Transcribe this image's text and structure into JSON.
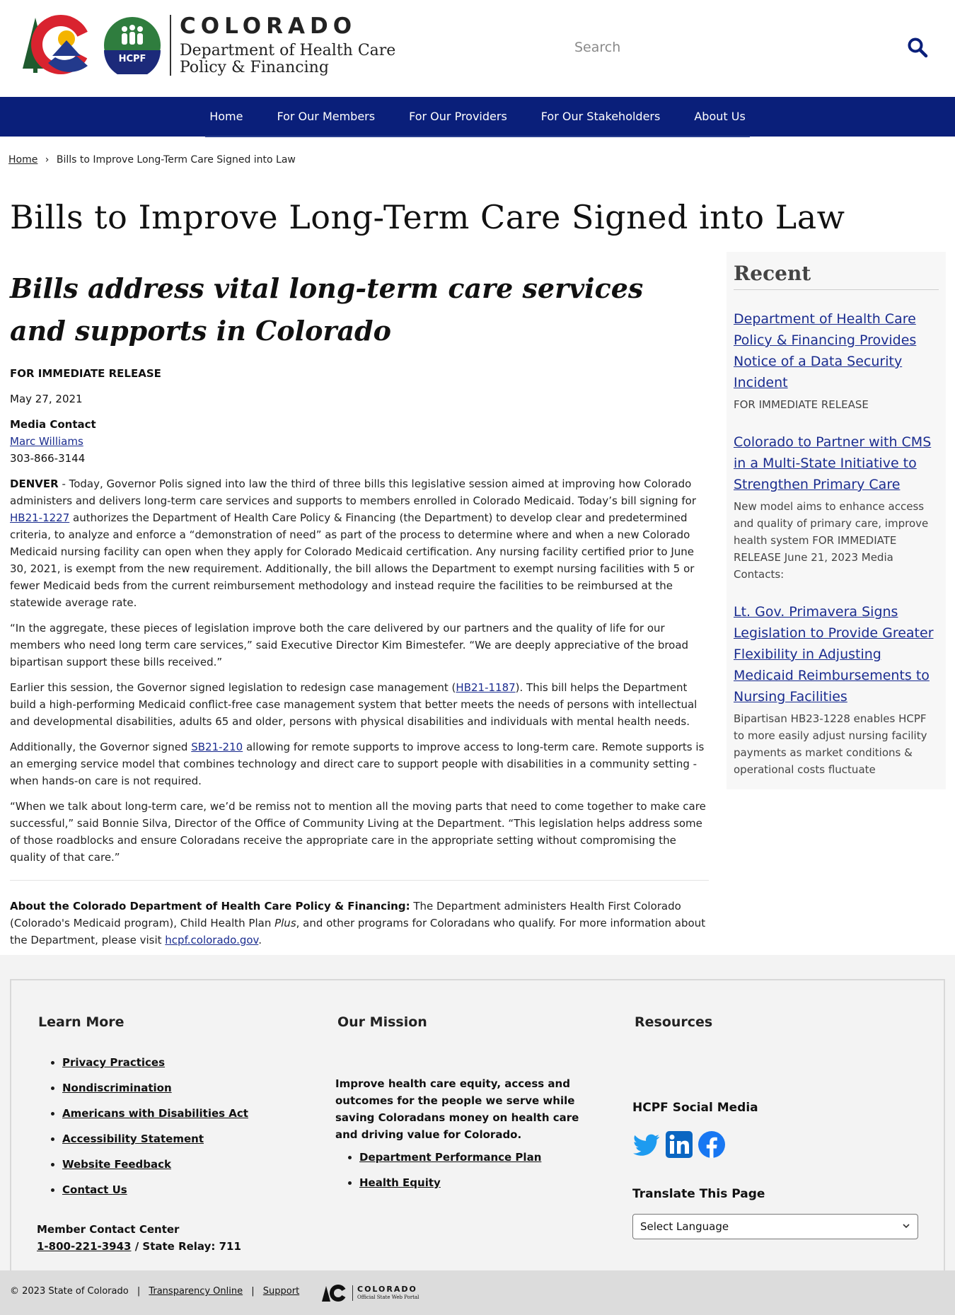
{
  "header": {
    "logo_state": "COLORADO",
    "logo_dept_line1": "Department of Health Care",
    "logo_dept_line2": "Policy & Financing",
    "hcpf_badge": "HCPF",
    "search_placeholder": "Search"
  },
  "nav": {
    "items": [
      "Home",
      "For Our Members",
      "For Our Providers",
      "For Our Stakeholders",
      "About Us"
    ]
  },
  "breadcrumb": {
    "home": "Home",
    "separator": "›",
    "current": "Bills to Improve Long-Term Care Signed into Law"
  },
  "page_title": "Bills to Improve Long-Term Care Signed into Law",
  "article": {
    "subtitle": "Bills address vital long-term care services and supports in Colorado",
    "release": "FOR IMMEDIATE RELEASE",
    "date": "May 27, 2021",
    "contact_label": "Media Contact",
    "contact_name": "Marc Williams",
    "contact_phone": "303-866-3144",
    "p1_lead": "DENVER",
    "p1_a": " - Today, Governor Polis signed into law the third of three bills this legislative session aimed at improving how Colorado administers and delivers long-term care services and supports to members enrolled in Colorado Medicaid. Today’s bill signing for ",
    "p1_link": "HB21-1227",
    "p1_b": " authorizes the Department of Health Care Policy & Financing (the Department) to develop clear and predetermined criteria, to analyze and enforce a “demonstration of need” as part of the process to determine where and when a new Colorado Medicaid nursing facility can open when they apply for Colorado Medicaid certification. Any nursing facility certified prior to June 30, 2021, is exempt from the new requirement. Additionally, the bill allows the Department to exempt nursing facilities with 5 or fewer Medicaid beds from the current reimbursement methodology and instead require the facilities to be reimbursed at the statewide average rate.",
    "p2": "“In the aggregate, these pieces of legislation improve both the care delivered by our partners and the quality of life for our members who need long term care services,” said Executive Director Kim Bimestefer. “We are deeply appreciative of the broad bipartisan support these bills received.”",
    "p3_a": "Earlier this session, the Governor signed legislation to redesign case management (",
    "p3_link": "HB21-1187",
    "p3_b": "). This bill helps the Department build a high-performing Medicaid conflict-free case management system that better meets the needs of persons with intellectual and developmental disabilities, adults 65 and older, persons with physical disabilities and individuals with mental health needs.",
    "p4_a": "Additionally, the Governor signed ",
    "p4_link": "SB21-210",
    "p4_b": " allowing for remote supports to improve access to long-term care. Remote supports is an emerging service model that combines technology and direct care to support people with disabilities in a community setting - when hands-on care is not required.",
    "p5": "“When we talk about long-term care, we’d be remiss not to mention all the moving parts that need to come together to make care successful,” said Bonnie Silva, Director of the Office of Community Living at the Department. “This legislation helps address some of those roadblocks and ensure Coloradans receive the appropriate care in the appropriate setting without compromising the quality of that care.”",
    "about_lead": "About the Colorado Department of Health Care Policy & Financing:",
    "about_a": " The Department administers Health First Colorado (Colorado's Medicaid program), Child Health Plan ",
    "about_plus": "Plus",
    "about_b": ", and other programs for Coloradans who qualify. For more information about the Department, please visit ",
    "about_link": "hcpf.colorado.gov",
    "about_end": "."
  },
  "sidebar": {
    "title": "Recent",
    "items": [
      {
        "link": "Department of Health Care Policy & Financing Provides Notice of a Data Security Incident",
        "desc": "FOR IMMEDIATE RELEASE"
      },
      {
        "link": "Colorado to Partner with CMS in a Multi-State Initiative to Strengthen Primary Care",
        "desc": "New model aims to enhance access and quality of primary care, improve health system FOR IMMEDIATE RELEASE  June 21, 2023 Media Contacts:"
      },
      {
        "link": "Lt. Gov. Primavera Signs Legislation to Provide Greater Flexibility in Adjusting Medicaid Reimbursements to Nursing Facilities",
        "desc": "Bipartisan HB23-1228 enables HCPF to more easily adjust nursing facility payments as market conditions & operational costs fluctuate"
      }
    ]
  },
  "footer": {
    "learn_more_title": "Learn More",
    "learn_more_links": [
      "Privacy Practices",
      "Nondiscrimination",
      "Americans with Disabilities Act",
      "Accessibility Statement",
      "Website Feedback",
      "Contact Us"
    ],
    "member_center_label": "Member Contact Center",
    "member_phone": "1-800-221-3943",
    "member_relay": " / State Relay: 711",
    "mission_title": "Our Mission",
    "mission_text": "Improve health care equity, access and outcomes for the people we serve while saving Coloradans money on health care and driving value for Colorado.",
    "mission_links": [
      "Department Performance Plan",
      "Health Equity"
    ],
    "resources_title": "Resources",
    "social_title": "HCPF Social Media",
    "social_icons": [
      "twitter-icon",
      "linkedin-icon",
      "facebook-icon"
    ],
    "translate_title": "Translate This Page",
    "language_select": "Select Language"
  },
  "bottom_bar": {
    "copyright": "© 2023 State of Colorado",
    "separator": "|",
    "transparency": "Transparency Online",
    "support": "Support",
    "portal_state": "COLORADO",
    "portal_sub": "Official State Web Portal"
  },
  "colors": {
    "nav_bg": "#0a1f7a",
    "link": "#1a2c8f",
    "footer_bg": "#f3f3f3",
    "bottom_bar_bg": "#dcdcdc"
  }
}
